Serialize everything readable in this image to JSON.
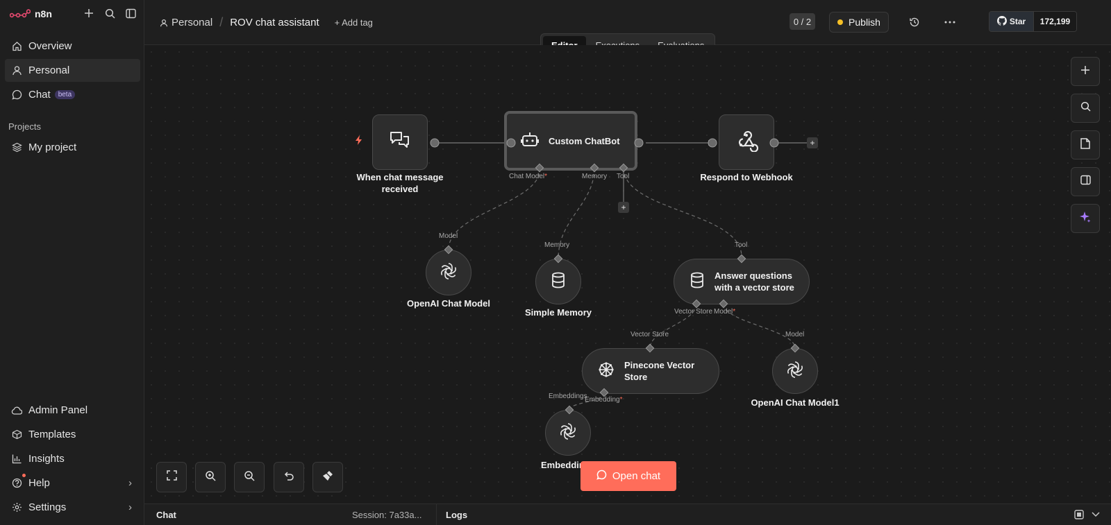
{
  "app": {
    "name": "n8n"
  },
  "sidebar": {
    "items": [
      {
        "label": "Overview",
        "icon": "home-icon"
      },
      {
        "label": "Personal",
        "icon": "user-icon"
      },
      {
        "label": "Chat",
        "icon": "chat-icon",
        "badge": "beta"
      }
    ],
    "projects_label": "Projects",
    "projects": [
      {
        "label": "My project",
        "icon": "layers-icon"
      }
    ],
    "bottom_items": [
      {
        "label": "Admin Panel",
        "icon": "cloud-icon"
      },
      {
        "label": "Templates",
        "icon": "box-icon"
      },
      {
        "label": "Insights",
        "icon": "bar-chart-icon"
      },
      {
        "label": "Help",
        "icon": "help-icon"
      },
      {
        "label": "Settings",
        "icon": "gear-icon"
      }
    ]
  },
  "header": {
    "breadcrumb_owner": "Personal",
    "separator": "/",
    "workflow_name": "ROV chat assistant",
    "add_tag": "+ Add tag",
    "counter": "0 / 2",
    "publish_label": "Publish",
    "github_star": "Star",
    "github_count": "172,199"
  },
  "tabs": [
    {
      "label": "Editor",
      "active": true
    },
    {
      "label": "Executions",
      "active": false
    },
    {
      "label": "Evaluations",
      "active": false
    }
  ],
  "nodes": {
    "trigger": {
      "label": "When chat message received"
    },
    "agent": {
      "label": "Custom ChatBot",
      "ports": {
        "chat_model": "Chat Model",
        "memory": "Memory",
        "tool": "Tool"
      }
    },
    "webhook": {
      "label": "Respond to Webhook"
    },
    "openai_model": {
      "label": "OpenAI Chat Model",
      "port": "Model"
    },
    "memory": {
      "label": "Simple Memory",
      "port": "Memory"
    },
    "vector_tool": {
      "label": "Answer questions with a vector store",
      "port": "Tool",
      "ports": {
        "vector_store": "Vector Store",
        "model": "Model"
      }
    },
    "pinecone": {
      "label": "Pinecone Vector Store",
      "port": "Vector Store",
      "ports": {
        "embedding": "Embedding"
      }
    },
    "openai_model1": {
      "label": "OpenAI Chat Model1",
      "port": "Model"
    },
    "embeddings": {
      "label": "Embeddings",
      "port": "Embeddings"
    }
  },
  "required_mark": "*",
  "open_chat": "Open chat",
  "bottom": {
    "chat_label": "Chat",
    "session": "Session: 7a33a...",
    "logs_label": "Logs"
  },
  "colors": {
    "accent": "#ff6d5a",
    "publish_dot": "#f6c026",
    "assistant_sparkle": "#a77bff"
  }
}
